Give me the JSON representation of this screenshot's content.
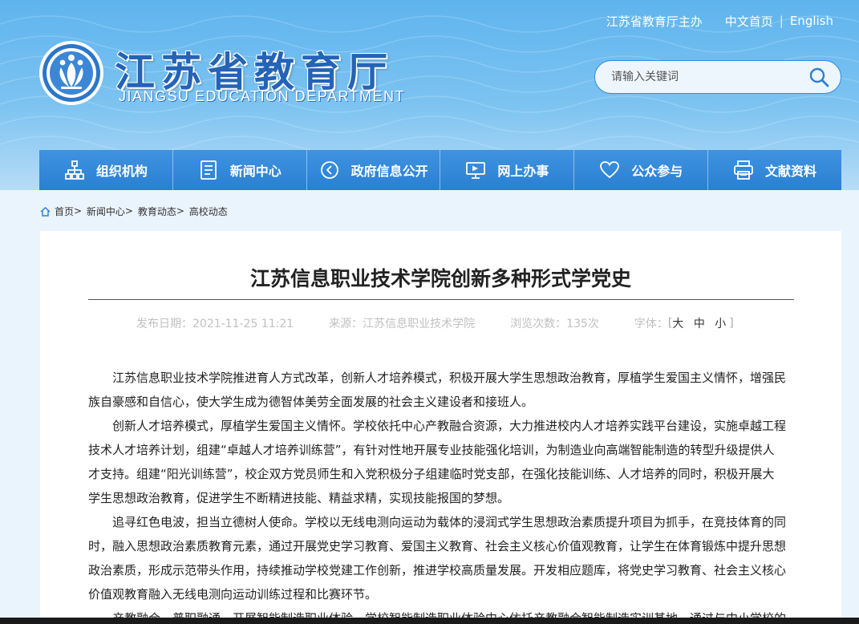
{
  "header": {
    "host_link": "江苏省教育厅主办",
    "lang_cn": "中文首页",
    "lang_sep": "|",
    "lang_en": "English",
    "logo_cn": "江苏省教育厅",
    "logo_en": "JIANGSU EDUCATION DEPARTMENT",
    "search_placeholder": "请输入关键词"
  },
  "nav": {
    "items": [
      {
        "label": "组织机构",
        "icon": "org-chart-icon"
      },
      {
        "label": "新闻中心",
        "icon": "document-icon"
      },
      {
        "label": "政府信息公开",
        "icon": "chevron-circle-icon"
      },
      {
        "label": "网上办事",
        "icon": "monitor-icon"
      },
      {
        "label": "公众参与",
        "icon": "heart-icon"
      },
      {
        "label": "文献资料",
        "icon": "printer-icon"
      }
    ]
  },
  "breadcrumb": {
    "items": [
      "首页",
      "新闻中心",
      "教育动态",
      "高校动态"
    ],
    "separator": ">"
  },
  "article": {
    "title": "江苏信息职业技术学院创新多种形式学党史",
    "date_label": "发布日期：2021-11-25 11:21",
    "source_label": "来源：江苏信息职业技术学院",
    "views_label": "浏览次数：",
    "views_count": "135次",
    "font_label": "字体：",
    "font_open": "[",
    "font_sizes": "大 中 小",
    "font_close": "]",
    "paragraphs": [
      "江苏信息职业技术学院推进育人方式改革，创新人才培养模式，积极开展大学生思想政治教育，厚植学生爱国主义情怀，增强民族自豪感和自信心，使大学生成为德智体美劳全面发展的社会主义建设者和接班人。",
      "创新人才培养模式，厚植学生爱国主义情怀。学校依托中心产教融合资源，大力推进校内人才培养实践平台建设，实施卓越工程技术人才培养计划，组建“卓越人才培养训练营”，有针对性地开展专业技能强化培训，为制造业向高端智能制造的转型升级提供人才支持。组建“阳光训练营”，校企双方党员师生和入党积极分子组建临时党支部，在强化技能训练、人才培养的同时，积极开展大学生思想政治教育，促进学生不断精进技能、精益求精，实现技能报国的梦想。",
      "追寻红色电波，担当立德树人使命。学校以无线电测向运动为载体的浸润式学生思想政治素质提升项目为抓手，在竞技体育的同时，融入思想政治素质教育元素，通过开展党史学习教育、爱国主义教育、社会主义核心价值观教育，让学生在体育锻炼中提升思想政治素质，形成示范带头作用，持续推动学校党建工作创新，推进学校高质量发展。开发相应题库，将党史学习教育、社会主义核心价值观教育融入无线电测向运动训练过程和比赛环节。",
      "产教融合，普职融通，开展智能制造职业体验。学校智能制造职业体验中心依托产教融合智能制造实训基地，通过与中小学校的"
    ]
  },
  "colors": {
    "brand_blue": "#2a7fd3",
    "header_sky": "#5fb4ee",
    "logo_text": "#2463b7"
  }
}
